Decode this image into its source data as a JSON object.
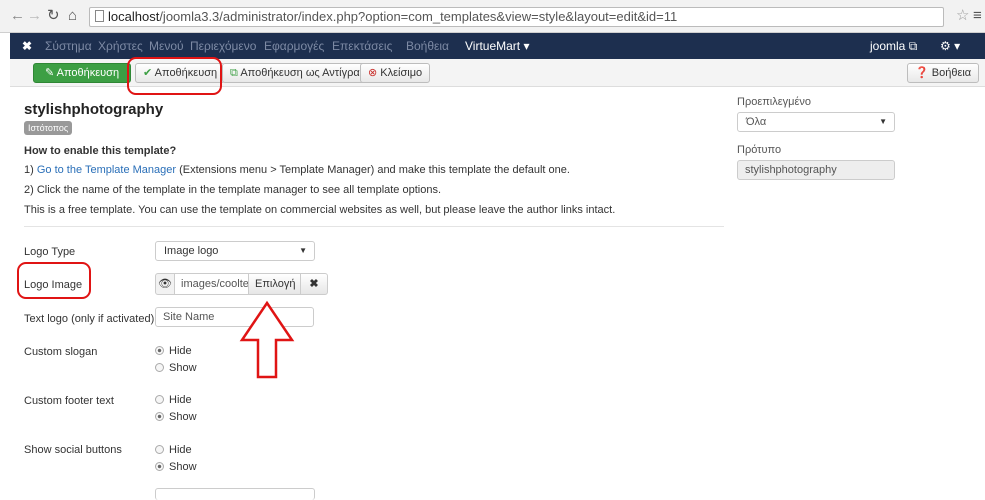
{
  "browser": {
    "url_host": "localhost",
    "url_path": "/joomla3.3/administrator/index.php?option=com_templates&view=style&layout=edit&id=11"
  },
  "topbar": {
    "menu": [
      "Σύστημα",
      "Χρήστες",
      "Μενού",
      "Περιεχόμενο",
      "Εφαρμογές",
      "Επεκτάσεις",
      "Βοήθεια"
    ],
    "virtuemart": "VirtueMart",
    "user": "joomla"
  },
  "toolbar": {
    "save": "Αποθήκευση",
    "apply": "Αποθήκευση",
    "save_copy": "Αποθήκευση ως Αντίγραφο",
    "close": "Κλείσιμο",
    "help": "Βοήθεια"
  },
  "page": {
    "title": "stylishphotography",
    "badge": "Ιστότοπος",
    "how_heading": "How to enable this template?",
    "step1_prefix": "1) ",
    "step1_link": "Go to the Template Manager",
    "step1_rest": " (Extensions menu > Template Manager) and make this template the default one.",
    "step2": "2) Click the name of the template in the template manager to see all template options.",
    "free_note": "This is a free template. You can use the template on commercial websites as well, but please leave the author links intact."
  },
  "fields": {
    "logo_type_label": "Logo Type",
    "logo_type_value": "Image logo",
    "logo_image_label": "Logo Image",
    "logo_image_path": "images/cooltext",
    "logo_image_select": "Επιλογή",
    "text_logo_label": "Text logo (only if activated)",
    "text_logo_value": "Site Name",
    "slogan_label": "Custom slogan",
    "footer_label": "Custom footer text",
    "social_label": "Show social buttons",
    "hide": "Hide",
    "show": "Show"
  },
  "sidebar": {
    "default_label": "Προεπιλεγμένο",
    "default_value": "Όλα",
    "template_label": "Πρότυπο",
    "template_value": "stylishphotography"
  },
  "colors": {
    "joomla_bar": "#1d2f4f",
    "save_green": "#3d9f44",
    "annotation_red": "#e01414",
    "link_blue": "#2a6fb8"
  }
}
